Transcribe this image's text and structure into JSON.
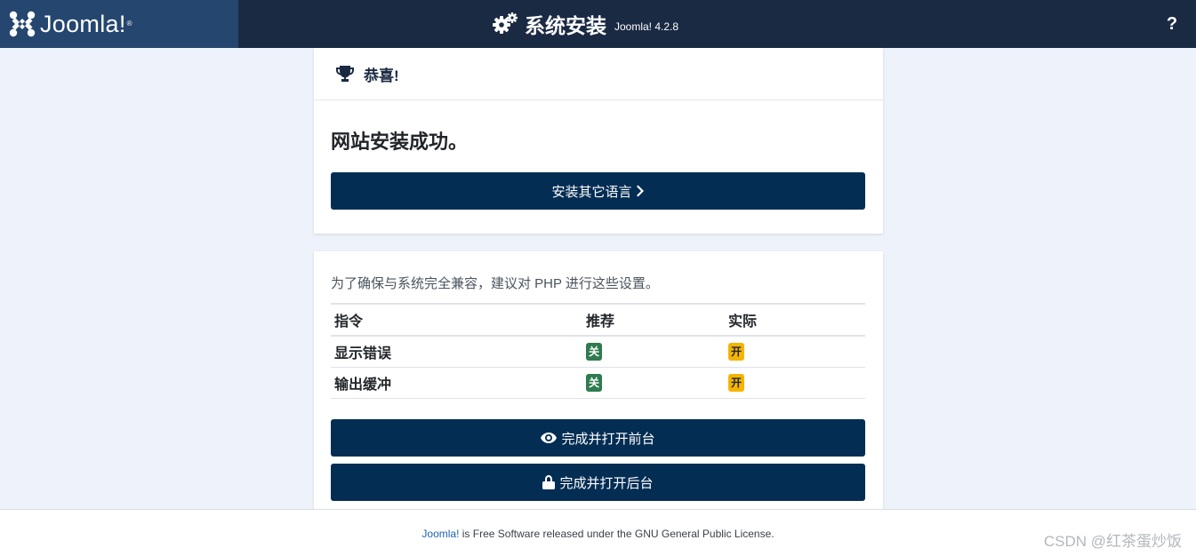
{
  "header": {
    "logo_text": "Joomla!",
    "title": "系统安装",
    "version": "Joomla! 4.2.8",
    "help_label": "?"
  },
  "congrats_card": {
    "heading": "恭喜!",
    "success_message": "网站安装成功。",
    "install_languages_button": "安装其它语言"
  },
  "php_card": {
    "note": "为了确保与系统完全兼容，建议对 PHP 进行这些设置。",
    "columns": [
      "指令",
      "推荐",
      "实际"
    ],
    "rows": [
      {
        "directive": "显示错误",
        "recommended": "关",
        "actual": "开"
      },
      {
        "directive": "输出缓冲",
        "recommended": "关",
        "actual": "开"
      }
    ],
    "open_site_button": "完成并打开前台",
    "open_admin_button": "完成并打开后台"
  },
  "footer": {
    "link_text": "Joomla!",
    "text": " is Free Software released under the GNU General Public License.",
    "watermark": "CSDN @红茶蛋炒饭"
  },
  "colors": {
    "header_bg": "#1b2a43",
    "logo_bg": "#24466f",
    "button_bg": "#042d54",
    "badge_off": "#2e7b4f",
    "badge_on": "#f4b400"
  }
}
